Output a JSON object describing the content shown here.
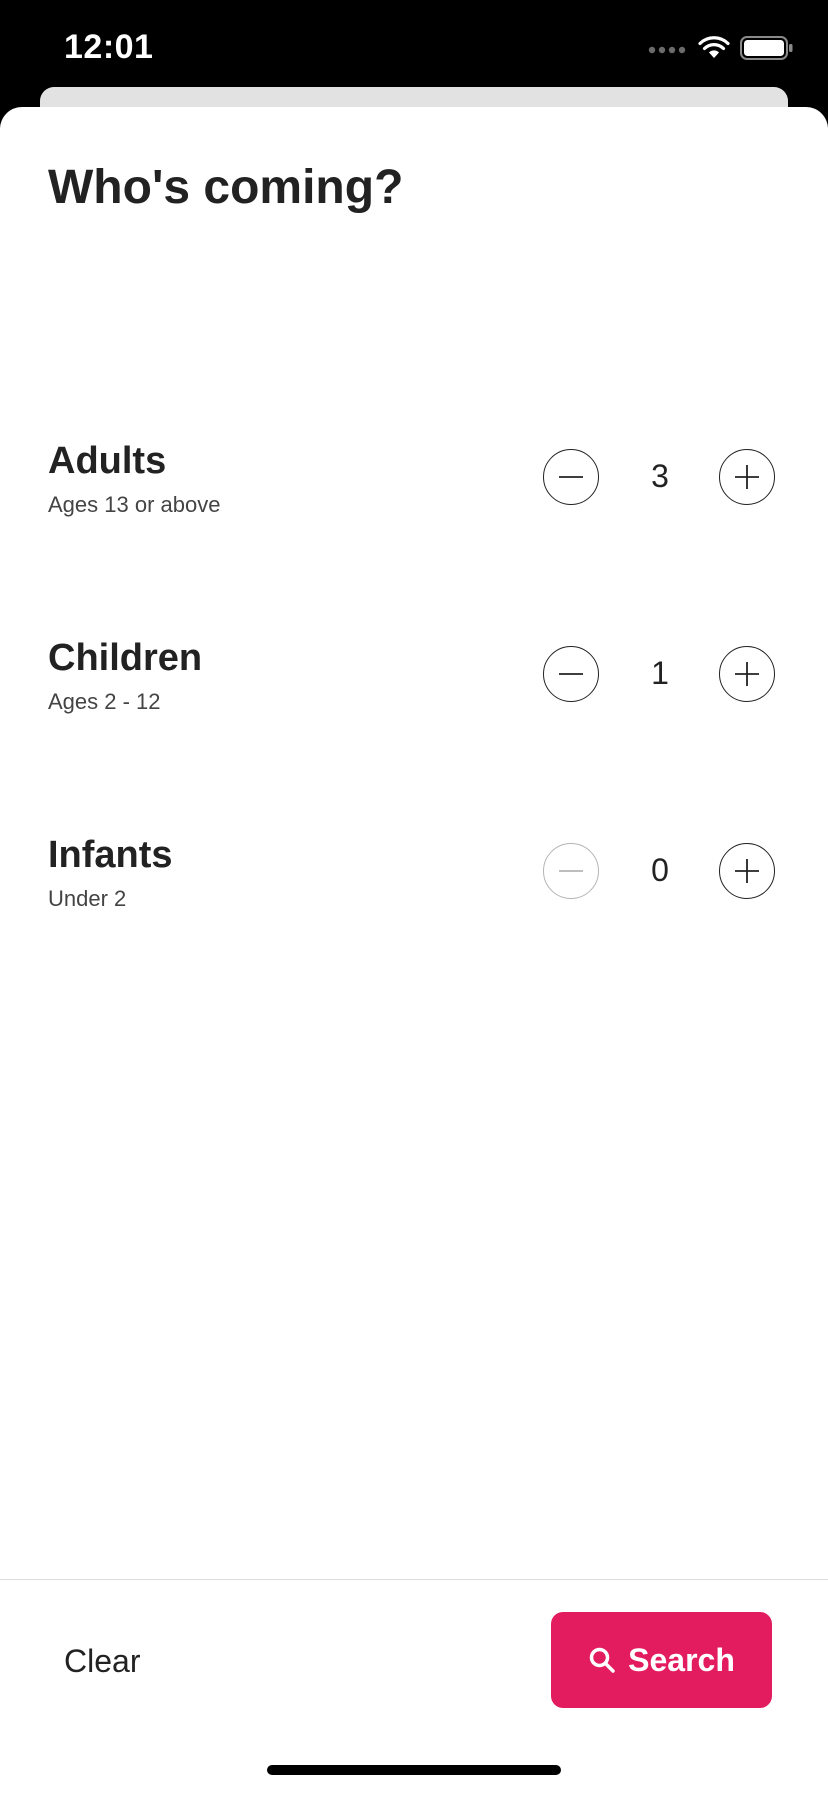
{
  "status_bar": {
    "time": "12:01",
    "icons": [
      "signal-icon",
      "wifi-icon",
      "battery-icon"
    ]
  },
  "sheet": {
    "title": "Who's coming?"
  },
  "guests": [
    {
      "label": "Adults",
      "sublabel": "Ages 13 or above",
      "count": "3",
      "minus_enabled": true
    },
    {
      "label": "Children",
      "sublabel": "Ages 2 - 12",
      "count": "1",
      "minus_enabled": true
    },
    {
      "label": "Infants",
      "sublabel": "Under 2",
      "count": "0",
      "minus_enabled": false
    }
  ],
  "footer": {
    "clear_label": "Clear",
    "search_label": "Search",
    "search_icon": "search-icon"
  },
  "colors": {
    "accent": "#e31c5f",
    "text": "#222222",
    "disabled": "#b5b5b5"
  }
}
